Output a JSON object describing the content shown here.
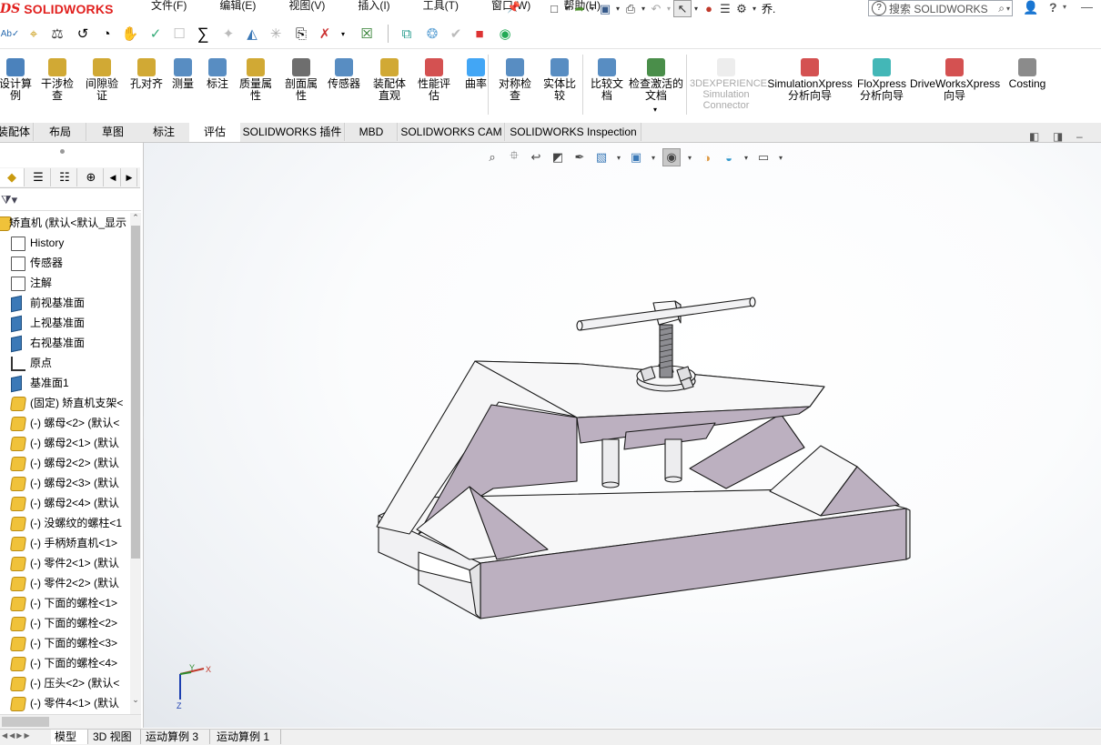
{
  "app": {
    "brand_ds": "DS",
    "brand_name": "SOLIDWORKS"
  },
  "menu": [
    "文件(F)",
    "编辑(E)",
    "视图(V)",
    "插入(I)",
    "工具(T)",
    "窗口(W)",
    "帮助(H)"
  ],
  "quick_access": {
    "doc_title_short": "乔.",
    "search_placeholder": "搜索 SOLIDWORKS",
    "help": "?"
  },
  "ribbon": {
    "commands": [
      {
        "label": "设计算例",
        "icon": "design-study-icon"
      },
      {
        "label": "干涉检查",
        "icon": "interference-icon"
      },
      {
        "label": "间隙验证",
        "icon": "clearance-icon"
      },
      {
        "label": "孔对齐",
        "icon": "hole-align-icon"
      },
      {
        "label": "测量",
        "icon": "measure-icon"
      },
      {
        "label": "标注",
        "icon": "markup-icon"
      },
      {
        "label": "质量属性",
        "icon": "mass-properties-icon"
      },
      {
        "label": "剖面属性",
        "icon": "section-properties-icon"
      },
      {
        "label": "传感器",
        "icon": "sensor-icon"
      },
      {
        "label": "装配体直观",
        "icon": "assembly-visualization-icon"
      },
      {
        "label": "性能评估",
        "icon": "performance-icon"
      },
      {
        "label": "曲率",
        "icon": "curvature-icon"
      },
      {
        "label": "对称检查",
        "icon": "symmetry-icon"
      },
      {
        "label": "实体比较",
        "icon": "compare-bodies-icon"
      },
      {
        "label": "比较文档",
        "icon": "compare-docs-icon"
      },
      {
        "label": "检查激活的文档",
        "icon": "check-doc-icon"
      },
      {
        "label": "3DEXPERIENCE Simulation Connector",
        "icon": "3dx-sim-icon",
        "disabled": true
      },
      {
        "label": "SimulationXpress 分析向导",
        "icon": "simxpress-icon"
      },
      {
        "label": "FloXpress 分析向导",
        "icon": "floxpress-icon"
      },
      {
        "label": "DriveWorksXpress 向导",
        "icon": "driveworks-icon"
      },
      {
        "label": "Costing",
        "icon": "costing-icon"
      }
    ]
  },
  "tabs": [
    "装配体",
    "布局",
    "草图",
    "标注",
    "评估",
    "SOLIDWORKS 插件",
    "MBD",
    "SOLIDWORKS CAM",
    "SOLIDWORKS Inspection"
  ],
  "active_tab": "评估",
  "feature_tree": {
    "root": "矫直机 (默认<默认_显示",
    "items": [
      {
        "label": "History",
        "type": "history"
      },
      {
        "label": "传感器",
        "type": "sensor"
      },
      {
        "label": "注解",
        "type": "annotation"
      },
      {
        "label": "前视基准面",
        "type": "plane"
      },
      {
        "label": "上视基准面",
        "type": "plane"
      },
      {
        "label": "右视基准面",
        "type": "plane"
      },
      {
        "label": "原点",
        "type": "origin"
      },
      {
        "label": "基准面1",
        "type": "plane"
      },
      {
        "label": "(固定) 矫直机支架<",
        "type": "part"
      },
      {
        "label": "(-) 螺母<2> (默认<",
        "type": "part"
      },
      {
        "label": "(-) 螺母2<1> (默认",
        "type": "part"
      },
      {
        "label": "(-) 螺母2<2> (默认",
        "type": "part"
      },
      {
        "label": "(-) 螺母2<3> (默认",
        "type": "part"
      },
      {
        "label": "(-) 螺母2<4> (默认",
        "type": "part"
      },
      {
        "label": "(-) 没螺纹的螺柱<1",
        "type": "part"
      },
      {
        "label": "(-) 手柄矫直机<1>",
        "type": "part"
      },
      {
        "label": "(-) 零件2<1> (默认",
        "type": "part"
      },
      {
        "label": "(-) 零件2<2> (默认",
        "type": "part"
      },
      {
        "label": "(-) 下面的螺栓<1>",
        "type": "part"
      },
      {
        "label": "(-) 下面的螺栓<2>",
        "type": "part"
      },
      {
        "label": "(-) 下面的螺栓<3>",
        "type": "part"
      },
      {
        "label": "(-) 下面的螺栓<4>",
        "type": "part"
      },
      {
        "label": "(-) 压头<2> (默认<",
        "type": "part"
      },
      {
        "label": "(-) 零件4<1> (默认",
        "type": "part"
      }
    ]
  },
  "bottom_tabs": [
    "模型",
    "3D 视图",
    "运动算例 3",
    "运动算例 1"
  ],
  "active_bottom_tab": "模型",
  "triad": {
    "x": "X",
    "y": "Y",
    "z": "Z"
  },
  "colors": {
    "accent_red": "#e1201e",
    "part_face": "#bcb0c0",
    "white_face": "#f7f7f8"
  }
}
